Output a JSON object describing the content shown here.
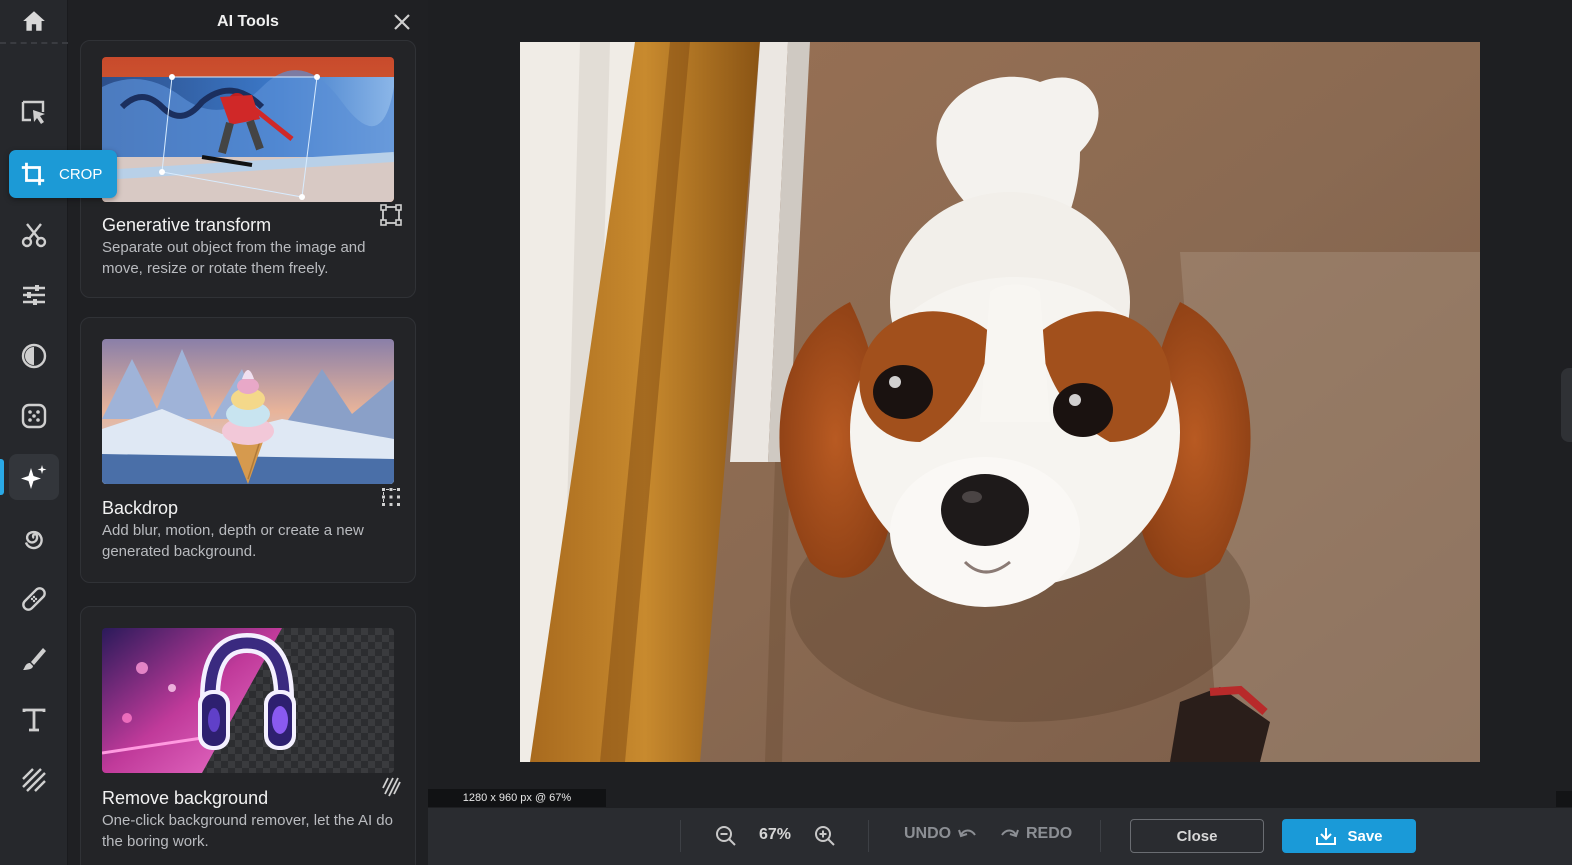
{
  "panel": {
    "title": "AI Tools",
    "cards": [
      {
        "title": "Generative transform",
        "desc": "Separate out object from the image and move, resize or rotate them freely.",
        "icon": "transform-icon"
      },
      {
        "title": "Backdrop",
        "desc": "Add blur, motion, depth or create a new generated background.",
        "icon": "backdrop-icon"
      },
      {
        "title": "Remove background",
        "desc": "One-click background remover, let the AI do the boring work.",
        "icon": "remove-bg-icon"
      }
    ]
  },
  "rail": {
    "crop_label": "CROP",
    "items": [
      "home-icon",
      "select-icon",
      "crop-icon",
      "cut-icon",
      "adjust-icon",
      "contrast-icon",
      "filter-icon",
      "ai-sparkle-icon",
      "spiral-icon",
      "heal-icon",
      "brush-icon",
      "text-icon",
      "texture-icon"
    ]
  },
  "canvas": {
    "dims": "1280 x 960 px @ 67%"
  },
  "toolbar": {
    "zoom": "67%",
    "undo": "UNDO",
    "redo": "REDO",
    "close": "Close",
    "save": "Save"
  },
  "colors": {
    "accent": "#1a9ad8",
    "panel_bg": "#1f2023",
    "rail_bg": "#26282c"
  }
}
